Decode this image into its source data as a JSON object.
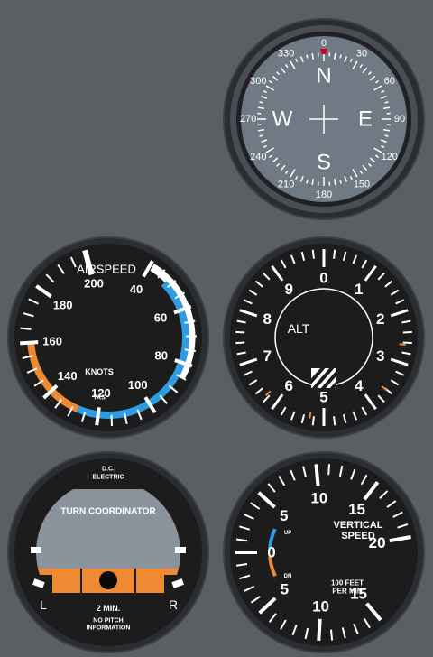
{
  "colors": {
    "background": "#5b5e63",
    "bezel": "#2a2d31",
    "face": "#1c1c1c",
    "compass_face": "#6f7a85",
    "airspeed_white_arc": "#ffffff",
    "airspeed_blue_arc": "#2f9be0",
    "airspeed_orange_arc": "#f08a32",
    "turn_orange": "#f08a32",
    "turn_sky": "#8a939c"
  },
  "compass": {
    "north": "N",
    "east": "E",
    "south": "S",
    "west": "W",
    "ticks_labels": [
      "0",
      "30",
      "60",
      "90",
      "120",
      "150",
      "180",
      "210",
      "240",
      "270",
      "300",
      "330"
    ],
    "heading": 0
  },
  "airspeed": {
    "title": "AIRSPEED",
    "units": "KNOTS",
    "tas": "TAS",
    "numbers": [
      "40",
      "60",
      "80",
      "100",
      "120",
      "140",
      "160",
      "180",
      "200"
    ]
  },
  "altimeter": {
    "title": "ALT",
    "numbers": [
      "0",
      "1",
      "2",
      "3",
      "4",
      "5",
      "6",
      "7",
      "8",
      "9"
    ]
  },
  "turn": {
    "top_line1": "D.C.",
    "top_line2": "ELECTRIC",
    "title": "TURN COORDINATOR",
    "left": "L",
    "right": "R",
    "minutes": "2 MIN.",
    "bottom_line1": "NO PITCH",
    "bottom_line2": "INFORMATION"
  },
  "vsi": {
    "title_line1": "VERTICAL",
    "title_line2": "SPEED",
    "units_line1": "100 FEET",
    "units_line2": "PER MIN",
    "up": "UP",
    "dn": "DN",
    "numbers_top": [
      "5",
      "10",
      "15",
      "20"
    ],
    "numbers_bottom": [
      "5",
      "10",
      "15"
    ],
    "zero": "0"
  }
}
